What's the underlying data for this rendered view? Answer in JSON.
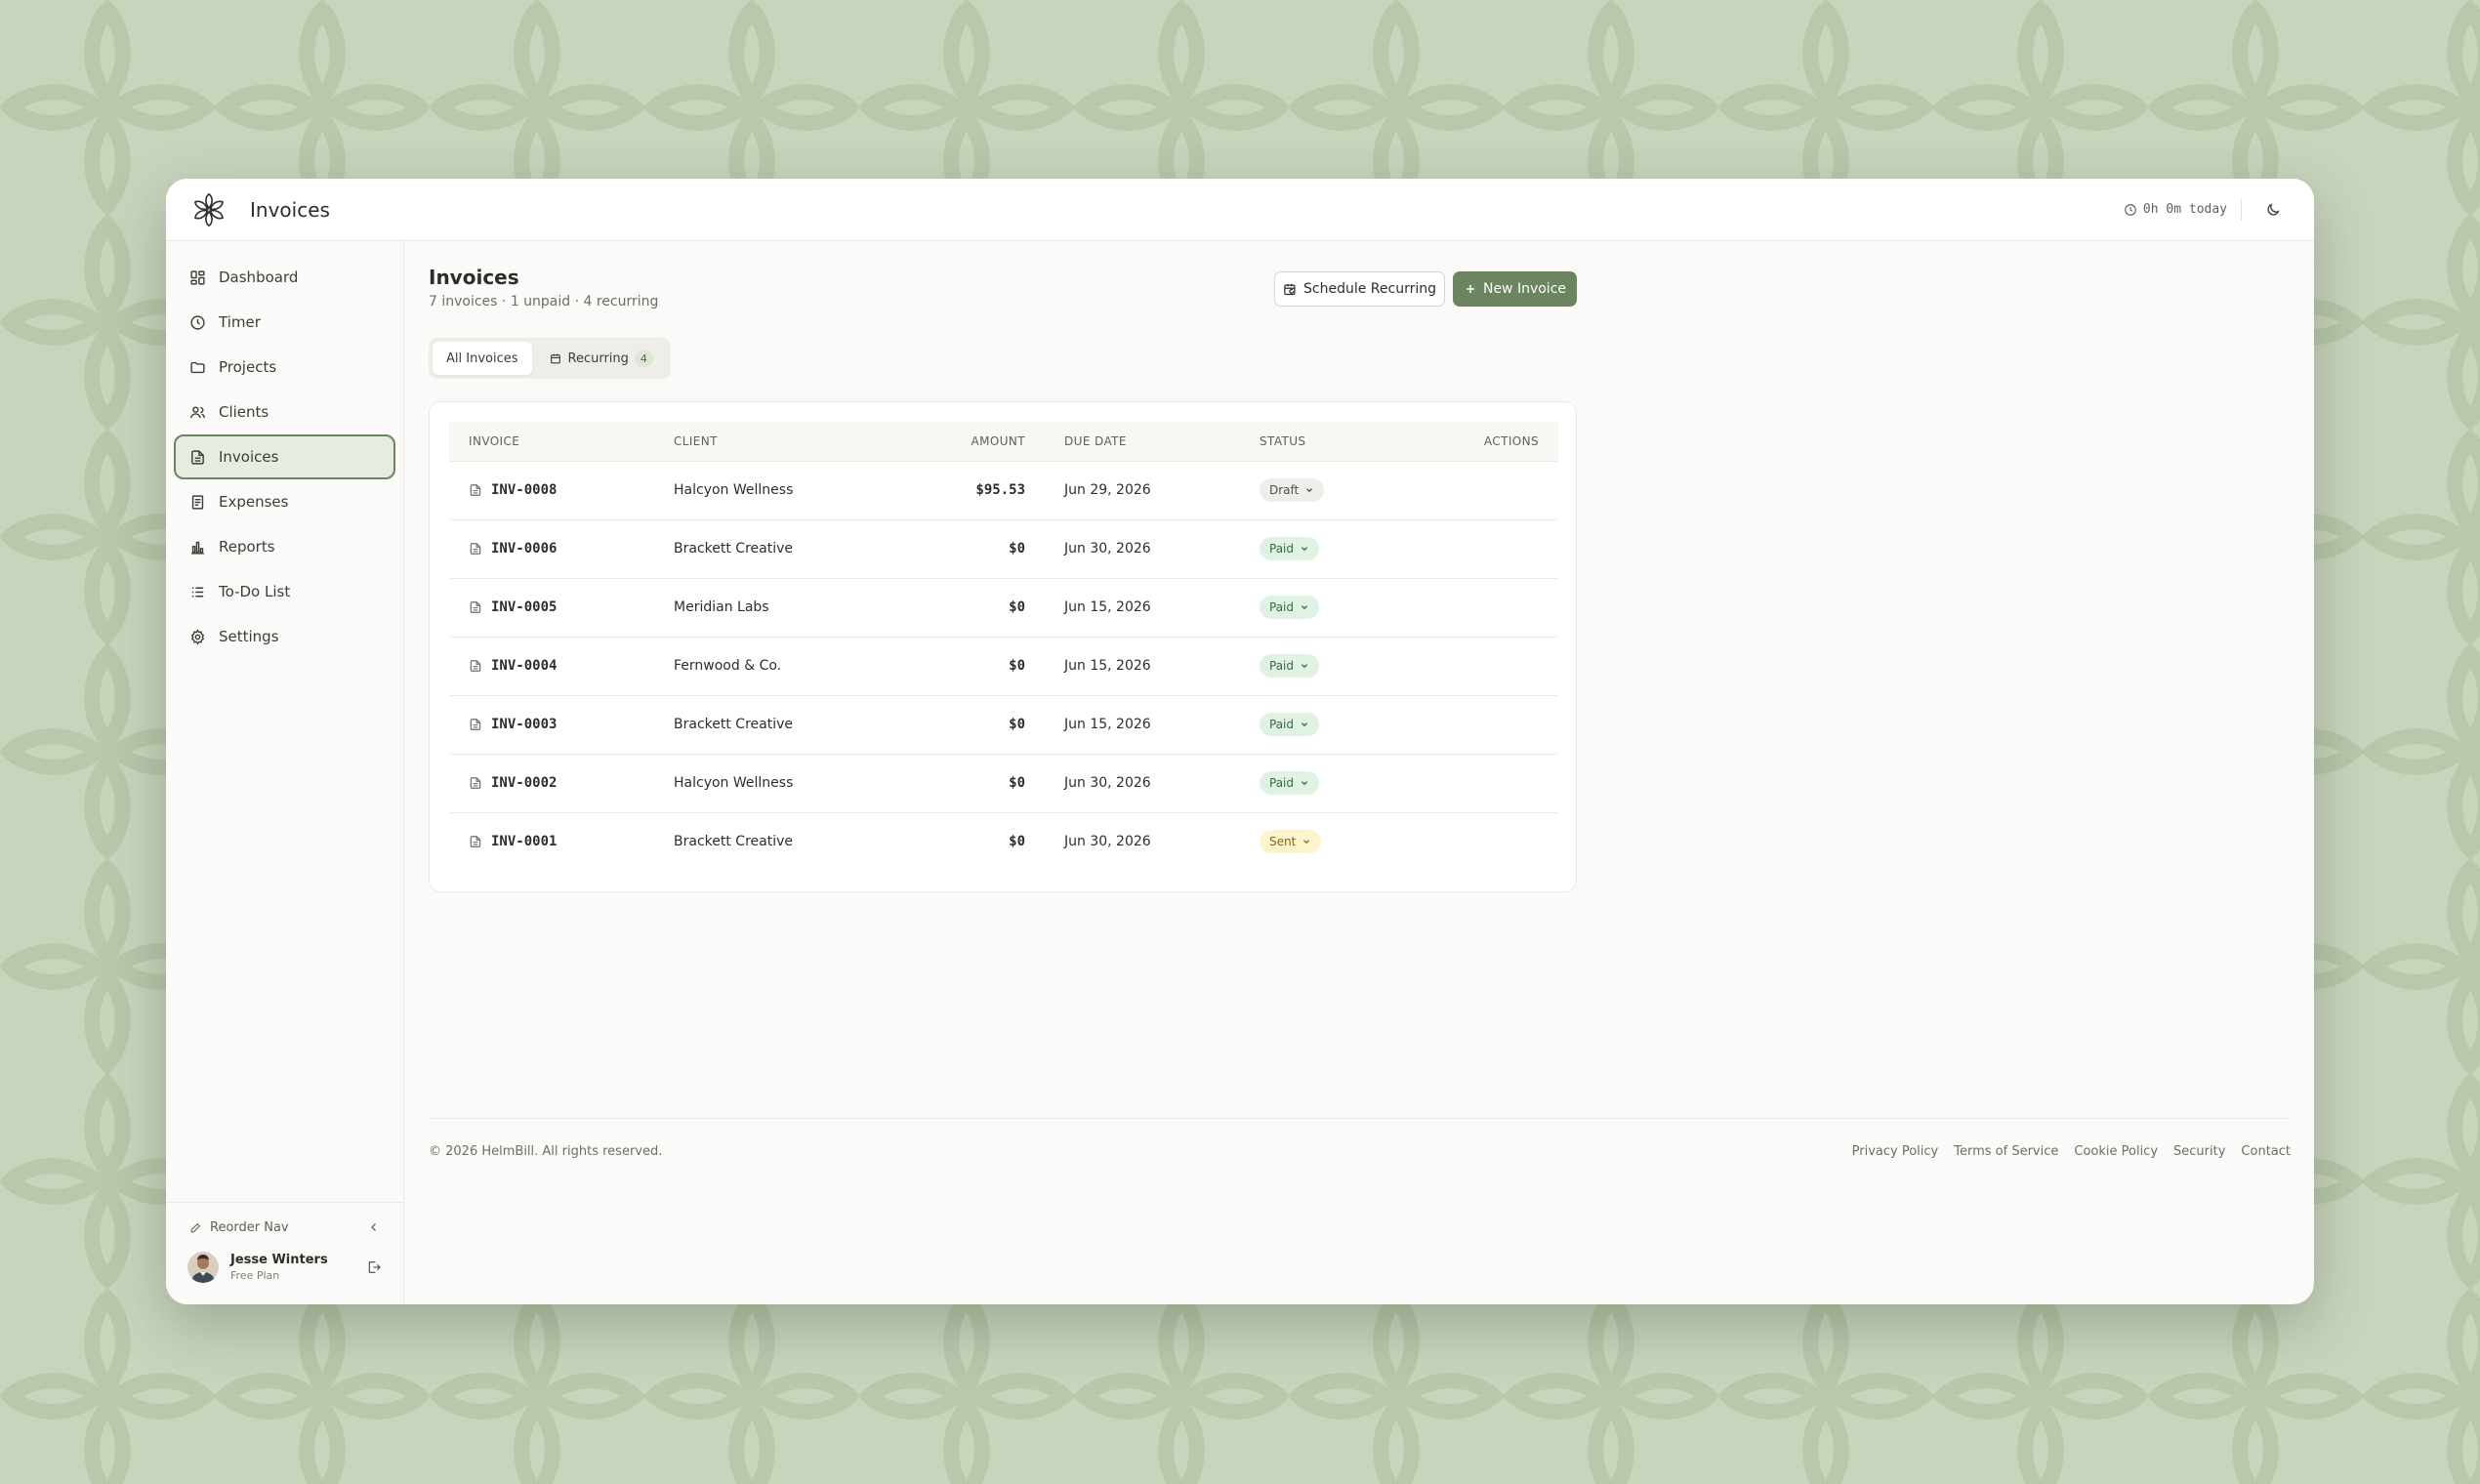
{
  "app": {
    "title": "Invoices",
    "timer_today": "0h 0m today"
  },
  "sidebar": {
    "items": [
      {
        "label": "Dashboard",
        "icon": "dashboard-icon"
      },
      {
        "label": "Timer",
        "icon": "clock-icon"
      },
      {
        "label": "Projects",
        "icon": "folder-icon"
      },
      {
        "label": "Clients",
        "icon": "users-icon"
      },
      {
        "label": "Invoices",
        "icon": "file-icon",
        "active": true
      },
      {
        "label": "Expenses",
        "icon": "receipt-icon"
      },
      {
        "label": "Reports",
        "icon": "bar-chart-icon"
      },
      {
        "label": "To-Do List",
        "icon": "list-icon"
      },
      {
        "label": "Settings",
        "icon": "gear-icon"
      }
    ],
    "reorder_label": "Reorder Nav",
    "user": {
      "name": "Jesse Winters",
      "plan": "Free Plan"
    }
  },
  "page": {
    "title": "Invoices",
    "subtitle": "7 invoices · 1 unpaid · 4 recurring",
    "schedule_button": "Schedule Recurring",
    "new_button": "New Invoice"
  },
  "tabs": {
    "all": "All Invoices",
    "recurring": "Recurring",
    "recurring_count": "4"
  },
  "table": {
    "headers": {
      "invoice": "INVOICE",
      "client": "CLIENT",
      "amount": "AMOUNT",
      "due": "DUE DATE",
      "status": "STATUS",
      "actions": "ACTIONS"
    },
    "rows": [
      {
        "id": "INV-0008",
        "client": "Halcyon Wellness",
        "amount": "$95.53",
        "due": "Jun 29, 2026",
        "status": "Draft",
        "status_type": "draft"
      },
      {
        "id": "INV-0006",
        "client": "Brackett Creative",
        "amount": "$0",
        "due": "Jun 30, 2026",
        "status": "Paid",
        "status_type": "paid"
      },
      {
        "id": "INV-0005",
        "client": "Meridian Labs",
        "amount": "$0",
        "due": "Jun 15, 2026",
        "status": "Paid",
        "status_type": "paid"
      },
      {
        "id": "INV-0004",
        "client": "Fernwood & Co.",
        "amount": "$0",
        "due": "Jun 15, 2026",
        "status": "Paid",
        "status_type": "paid"
      },
      {
        "id": "INV-0003",
        "client": "Brackett Creative",
        "amount": "$0",
        "due": "Jun 15, 2026",
        "status": "Paid",
        "status_type": "paid"
      },
      {
        "id": "INV-0002",
        "client": "Halcyon Wellness",
        "amount": "$0",
        "due": "Jun 30, 2026",
        "status": "Paid",
        "status_type": "paid"
      },
      {
        "id": "INV-0001",
        "client": "Brackett Creative",
        "amount": "$0",
        "due": "Jun 30, 2026",
        "status": "Sent",
        "status_type": "sent"
      }
    ]
  },
  "footer": {
    "copyright": "© 2026 HelmBill. All rights reserved.",
    "links": [
      "Privacy Policy",
      "Terms of Service",
      "Cookie Policy",
      "Security",
      "Contact"
    ]
  },
  "colors": {
    "accent": "#6b8560",
    "background": "#c9d4bd",
    "paid": "#2f6e3f",
    "sent": "#8a6512",
    "draft": "#4d5149"
  }
}
